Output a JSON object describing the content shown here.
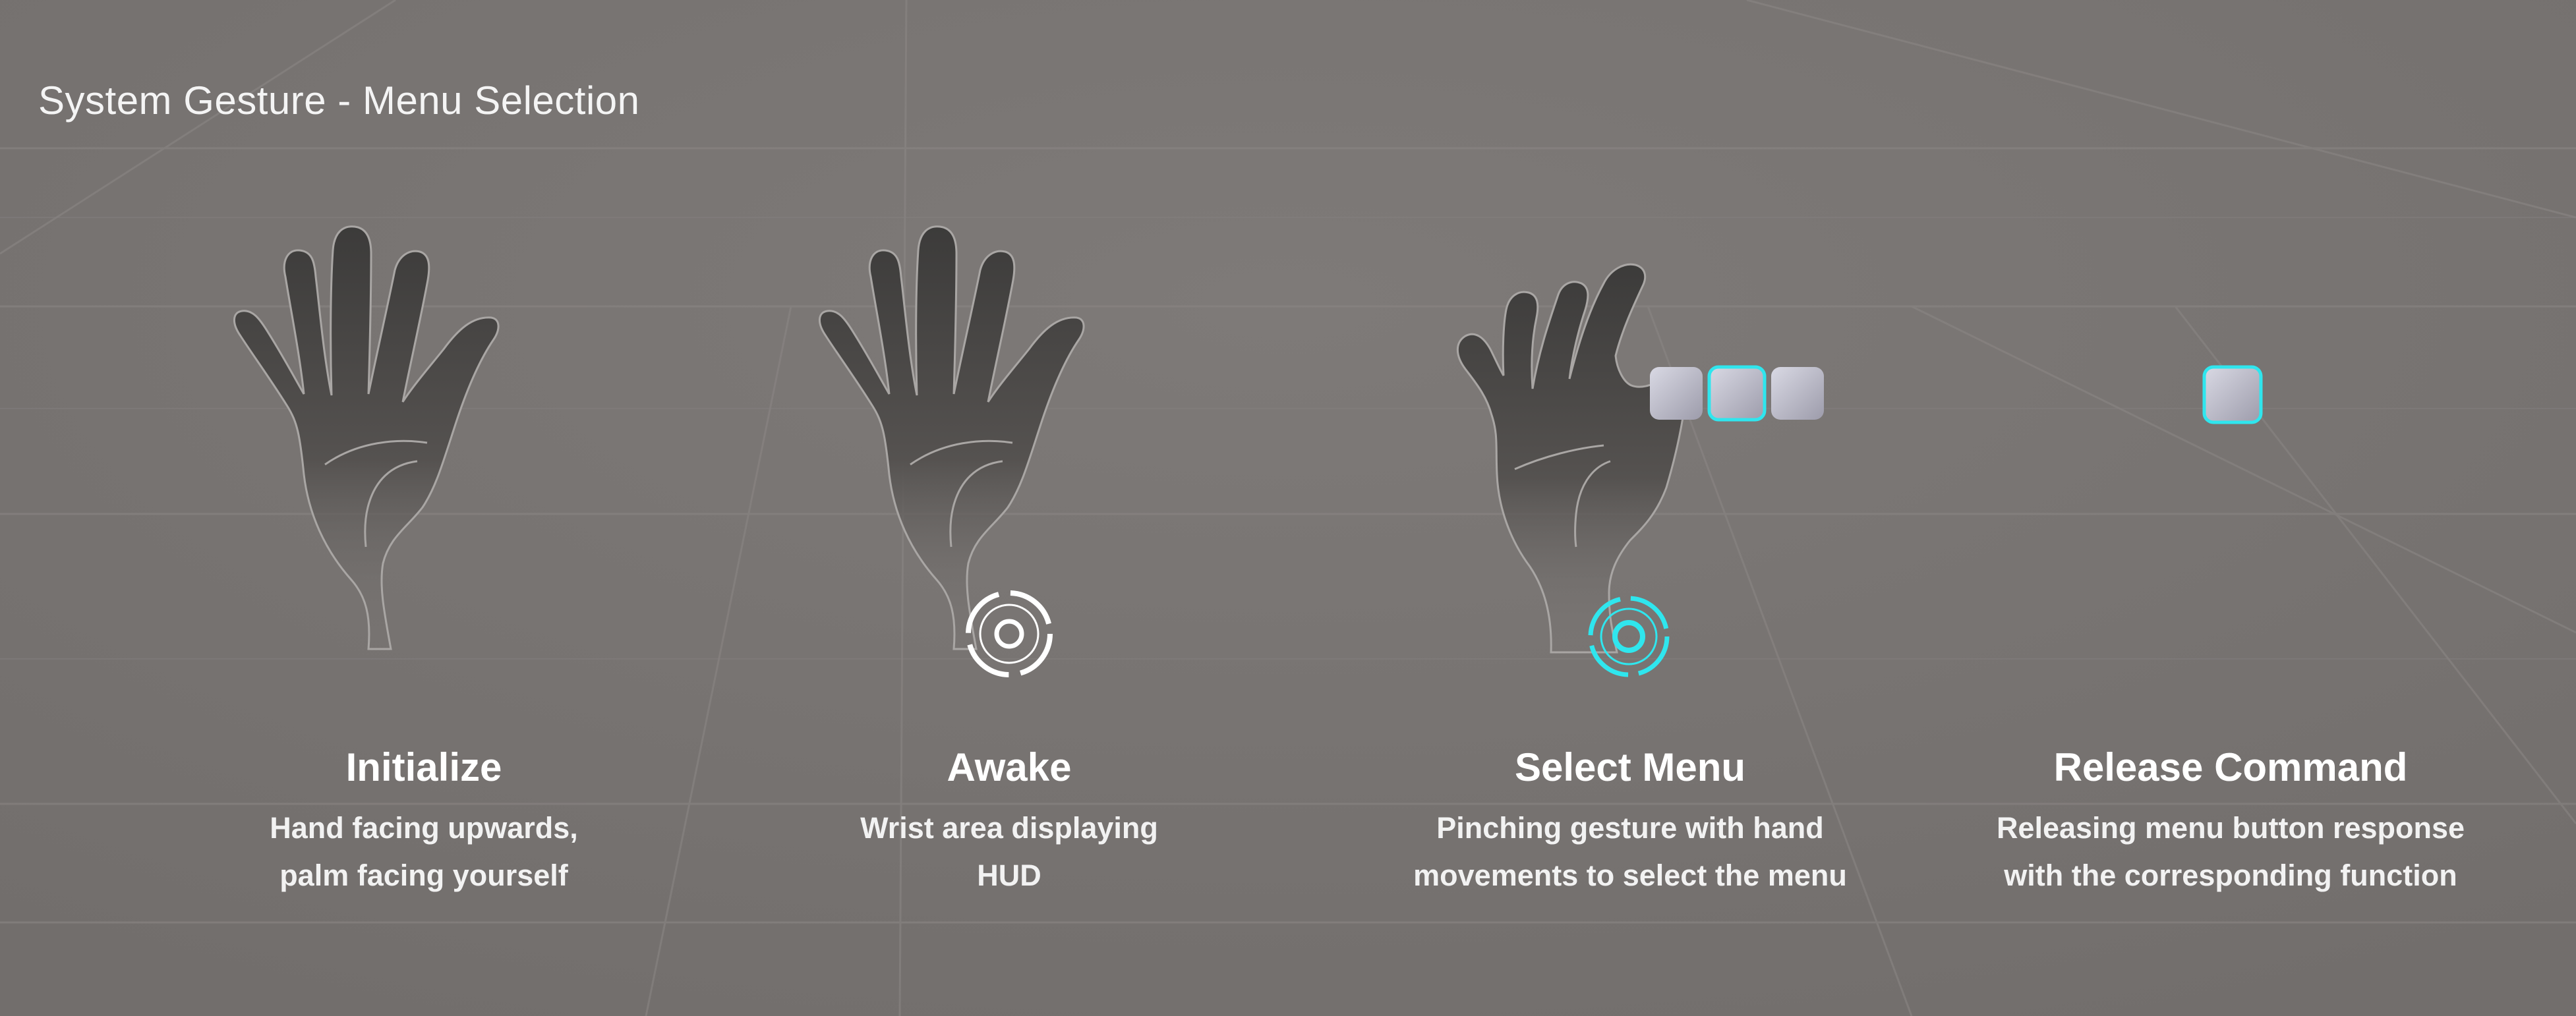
{
  "title": "System Gesture - Menu Selection",
  "colors": {
    "background": "#7a7674",
    "hand": "#4a4847",
    "hand_outline": "#a9a6a4",
    "accent_cyan": "#2fe6ee",
    "hud_white": "#ffffff",
    "menu_button": "#b9b8c6"
  },
  "steps": [
    {
      "title": "Initialize",
      "description": "Hand facing upwards,\npalm facing yourself",
      "icon": "open-hand-icon"
    },
    {
      "title": "Awake",
      "description": "Wrist area displaying\nHUD",
      "icon": "open-hand-with-hud-icon"
    },
    {
      "title": "Select Menu",
      "description": "Pinching gesture with hand\nmovements to select the menu",
      "icon": "pinching-hand-with-menu-icon"
    },
    {
      "title": "Release Command",
      "description": "Releasing menu button response\nwith the corresponding function",
      "icon": "released-menu-button-icon"
    }
  ]
}
